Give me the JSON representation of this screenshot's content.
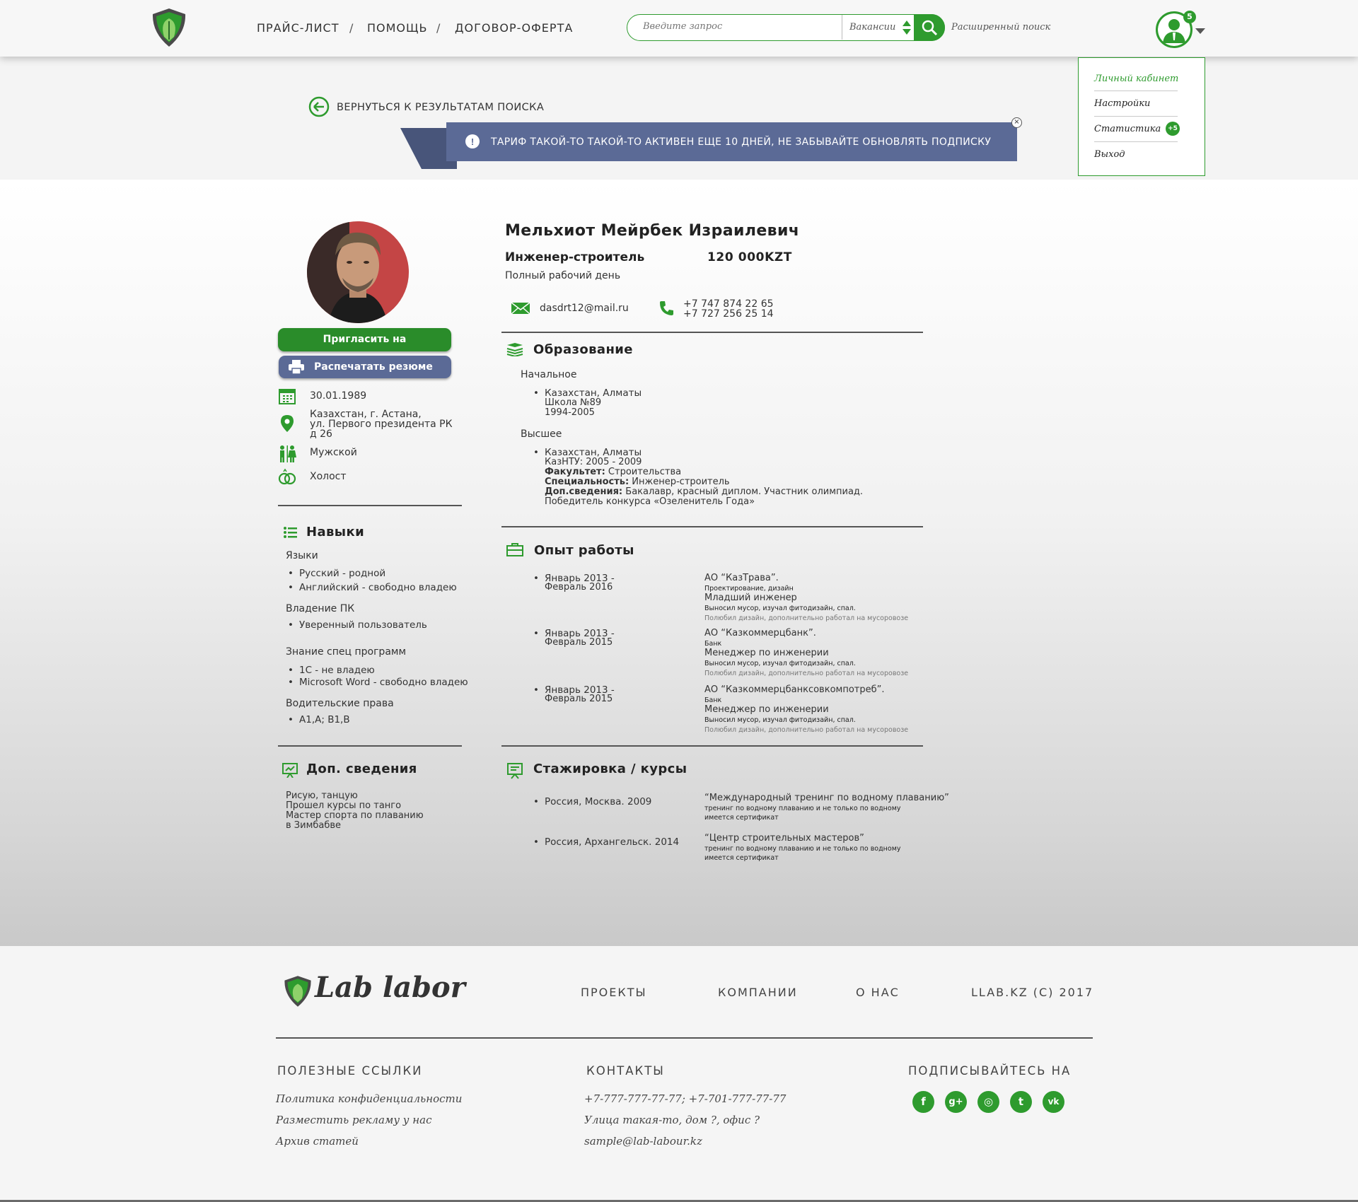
{
  "header": {
    "nav": [
      "ПРАЙС-ЛИСТ",
      "ПОМОЩЬ",
      "ДОГОВОР-ОФЕРТА"
    ],
    "nav_separator": "/",
    "search_placeholder": "Введите запрос",
    "search_category": "Вакансии",
    "advanced_search": "Расширенный поиск",
    "notifications": "5"
  },
  "user_menu": {
    "items": [
      "Личный кабинет",
      "Настройки",
      "Статистика",
      "Выход"
    ],
    "stat_badge": "+5"
  },
  "back_link": "ВЕРНУТЬСЯ К РЕЗУЛЬТАТАМ ПОИСКА",
  "banner": {
    "text": "ТАРИФ ТАКОЙ-ТО ТАКОЙ-ТО АКТИВЕН ЕЩЕ 10 ДНЕЙ, НЕ ЗАБЫВАЙТЕ ОБНОВЛЯТЬ ПОДПИСКУ",
    "icon": "!"
  },
  "candidate": {
    "name": "Мельхиот Мейрбек Израилевич",
    "position": "Инженер-строитель",
    "salary": "120 000KZT",
    "schedule": "Полный рабочий день",
    "email": "dasdrt12@mail.ru",
    "phones": [
      "+7 747 874 22 65",
      "+7 727 256 25 14"
    ]
  },
  "actions": {
    "invite": "Пригласить на собеседование",
    "print": "Распечатать резюме"
  },
  "personal": {
    "birthdate": "30.01.1989",
    "address": [
      "Казахстан, г. Астана,",
      "ул. Первого президента РК",
      "д 26"
    ],
    "gender": "Мужской",
    "marital": "Холост"
  },
  "skills": {
    "title": "Навыки",
    "groups": [
      {
        "title": "Языки",
        "items": [
          "Русский - родной",
          "Английский - свободно владею"
        ]
      },
      {
        "title": "Владение ПК",
        "items": [
          "Уверенный пользователь"
        ]
      },
      {
        "title": "Знание спец программ",
        "items": [
          "1С - не владею",
          "Microsoft Word - свободно владею"
        ]
      },
      {
        "title": "Водительские права",
        "items": [
          "A1,A; B1,B"
        ]
      }
    ]
  },
  "extra": {
    "title": "Доп. сведения",
    "lines": [
      "Рисую, танцую",
      "Прошел курсы по танго",
      "Мастер спорта по плаванию",
      "в Зимбабве"
    ]
  },
  "education": {
    "title": "Образование",
    "primary": {
      "title": "Начальное",
      "lines": [
        "Казахстан, Алматы",
        "Школа №89",
        "1994-2005"
      ]
    },
    "higher": {
      "title": "Высшее",
      "lines": [
        "Казахстан, Алматы",
        "КазНТУ: 2005 - 2009"
      ],
      "faculty_label": "Факультет:",
      "faculty": " Строительства",
      "specialty_label": "Специальность:",
      "specialty": " Инженер-строитель",
      "extra_label": "Доп.сведения:",
      "extra": " Бакалавр, красный диплом. Участник олимпиад.",
      "extra2": "Победитель конкурса «Озеленитель Года»"
    }
  },
  "experience": {
    "title": "Опыт работы",
    "jobs": [
      {
        "period": [
          "Январь 2013 -",
          "Февраль 2016"
        ],
        "company": "АО “КазТрава”.",
        "field": "Проектирование, дизайн",
        "role": "Младший инженер",
        "duties": "Выносил мусор, изучал фитодизайн, спал.",
        "note": "Полюбил дизайн, дополнительно работал на мусоровозе"
      },
      {
        "period": [
          "Январь 2013 -",
          "Февраль 2015"
        ],
        "company": "АО “Казкоммерцбанк”.",
        "field": "Банк",
        "role": "Менеджер по инженерии",
        "duties": "Выносил мусор, изучал фитодизайн, спал.",
        "note": "Полюбил дизайн, дополнительно работал на мусоровозе"
      },
      {
        "period": [
          "Январь 2013 -",
          "Февраль 2015"
        ],
        "company": "АО “Казкоммерцбанксовкомпотреб”.",
        "field": "Банк",
        "role": "Менеджер по инженерии",
        "duties": "Выносил мусор, изучал фитодизайн, спал.",
        "note": "Полюбил дизайн, дополнительно работал на мусоровозе"
      }
    ]
  },
  "training": {
    "title": "Стажировка / курсы",
    "items": [
      {
        "place": "Россия, Москва. 2009",
        "name": "“Международный тренинг по водному плаванию”",
        "desc": [
          "тренинг по водному плаванию и не только по водному",
          "имеется сертификат"
        ]
      },
      {
        "place": "Россия, Архангельск. 2014",
        "name": "“Центр строительных мастеров”",
        "desc": [
          "тренинг по водному плаванию и не только по водному",
          "имеется сертификат"
        ]
      }
    ]
  },
  "footer": {
    "logo": "Lab labor",
    "nav": [
      "ПРОЕКТЫ",
      "КОМПАНИИ",
      "О НАС",
      "LLAB.KZ (C) 2017"
    ],
    "useful_title": "ПОЛЕЗНЫЕ ССЫЛКИ",
    "useful_links": [
      "Политика конфиденциальности",
      "Разместить рекламу у нас",
      "Архив статей"
    ],
    "contacts_title": "КОНТАКТЫ",
    "contacts": [
      "+7-777-777-77-77; +7-701-777-77-77",
      "Улица такая-то, дом ?, офис ?",
      "sample@lab-labour.kz"
    ],
    "subscribe_title": "ПОДПИСЫВАЙТЕСЬ НА",
    "socials": [
      "facebook-icon",
      "google-plus-icon",
      "instagram-icon",
      "twitter-icon",
      "vk-icon"
    ],
    "social_glyphs": [
      "f",
      "g+",
      "◎",
      "t",
      "vk"
    ]
  },
  "colors": {
    "accent": "#2e9b2e",
    "banner": "#5b6a96"
  }
}
